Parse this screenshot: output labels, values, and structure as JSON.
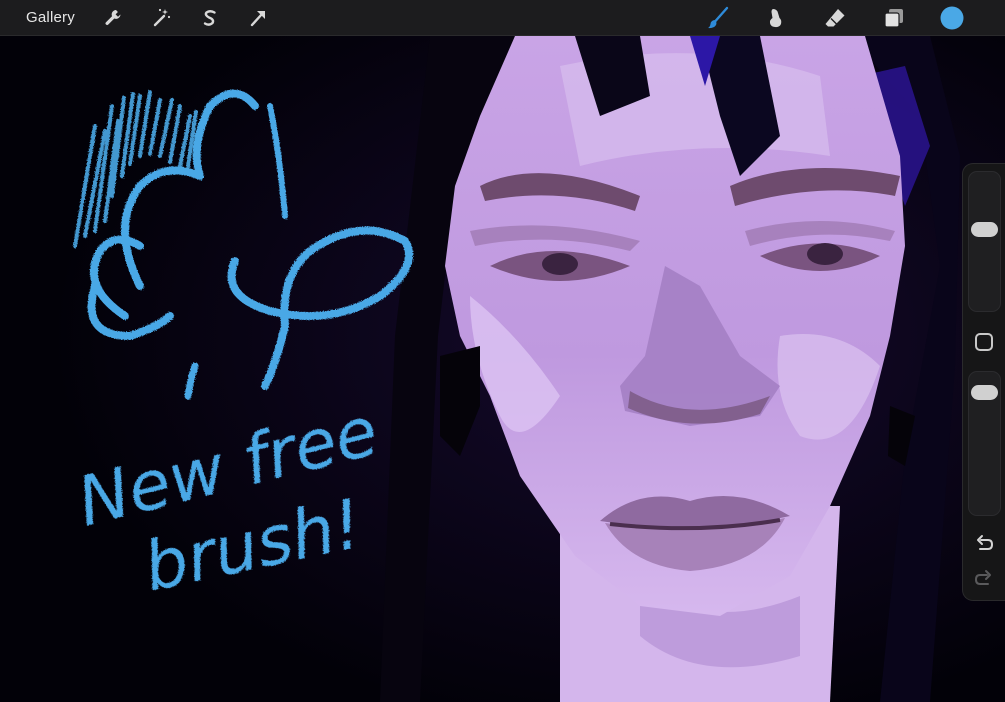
{
  "toolbar": {
    "gallery_label": "Gallery",
    "left_tools": [
      "wrench-icon",
      "magic-wand-icon",
      "selection-s-icon",
      "transform-arrow-icon"
    ],
    "right_tools": [
      "brush-icon",
      "smudge-icon",
      "eraser-icon",
      "layers-icon",
      "color-swatch"
    ],
    "active_tool": "brush-icon",
    "current_color": "#4aa8e6",
    "accent_color": "#2e8bd9"
  },
  "sidebar": {
    "brush_size": 0.6,
    "brush_opacity": 0.92,
    "buttons": [
      "modify-button",
      "undo-icon",
      "redo-icon"
    ]
  },
  "canvas": {
    "sketch_text_line1": "New free",
    "sketch_text_line2": "brush!",
    "sketch_color": "#4aa8e6"
  }
}
